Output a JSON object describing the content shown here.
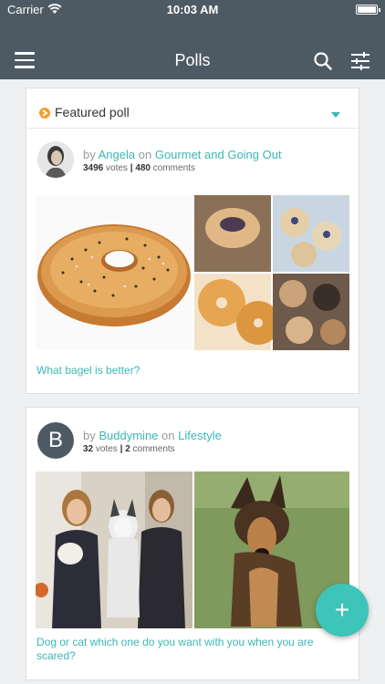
{
  "status_bar": {
    "carrier": "Carrier",
    "time": "10:03 AM"
  },
  "nav": {
    "title": "Polls"
  },
  "featured": {
    "label": "Featured poll"
  },
  "polls": [
    {
      "by_prefix": "by",
      "author": "Angela",
      "on_prefix": "on",
      "category": "Gourmet and Going Out",
      "votes": "3496",
      "votes_label": "votes",
      "separator": "|",
      "comments": "480",
      "comments_label": "comments",
      "question": "What bagel is better?"
    },
    {
      "avatar_letter": "B",
      "by_prefix": "by",
      "author": "Buddymine",
      "on_prefix": "on",
      "category": "Lifestyle",
      "votes": "32",
      "votes_label": "votes",
      "separator": "|",
      "comments": "2",
      "comments_label": "comments",
      "question": "Dog or cat which one do you want with you when you are scared?"
    }
  ],
  "fab": {
    "label": "+"
  },
  "colors": {
    "accent": "#3fb5b5",
    "navbar": "#4e5a63",
    "featured_icon": "#f0a030",
    "fab": "#3cc5b8"
  }
}
